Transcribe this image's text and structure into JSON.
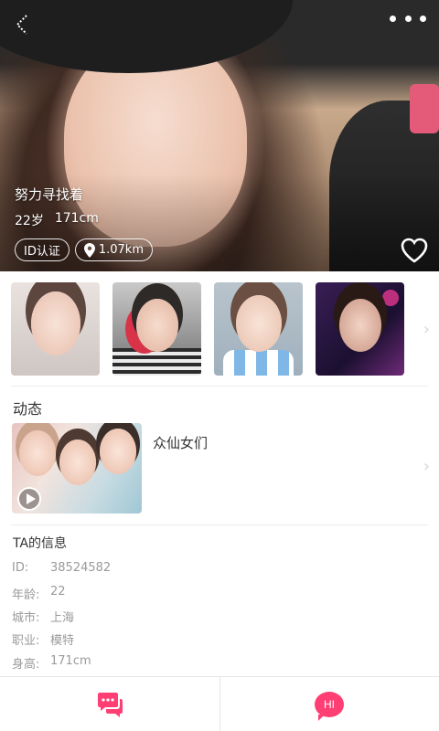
{
  "profile": {
    "name": "努力寻找着",
    "age": "22岁",
    "height": "171cm",
    "badges": {
      "id_verified": "ID认证",
      "distance": "1.07km"
    }
  },
  "moments": {
    "title": "动态",
    "items": [
      {
        "caption": "众仙女们",
        "type": "video"
      }
    ]
  },
  "info": {
    "title": "TA的信息",
    "rows": [
      {
        "label": "ID:",
        "value": "38524582"
      },
      {
        "label": "年龄:",
        "value": "22"
      },
      {
        "label": "城市:",
        "value": "上海"
      },
      {
        "label": "职业:",
        "value": "模特"
      },
      {
        "label": "身高:",
        "value": "171cm"
      }
    ]
  },
  "icons": {
    "back": "back-icon",
    "more": "more-icon",
    "like": "heart-icon",
    "location": "location-pin-icon",
    "play": "play-icon",
    "chat": "chat-bubble-icon",
    "greet": "hi-bubble-icon"
  },
  "bottom_bar": {
    "greet_label": "HI"
  },
  "colors": {
    "accent": "#ff3e74",
    "text": "#333333",
    "muted": "#9a9a9a",
    "divider": "#ececec"
  }
}
